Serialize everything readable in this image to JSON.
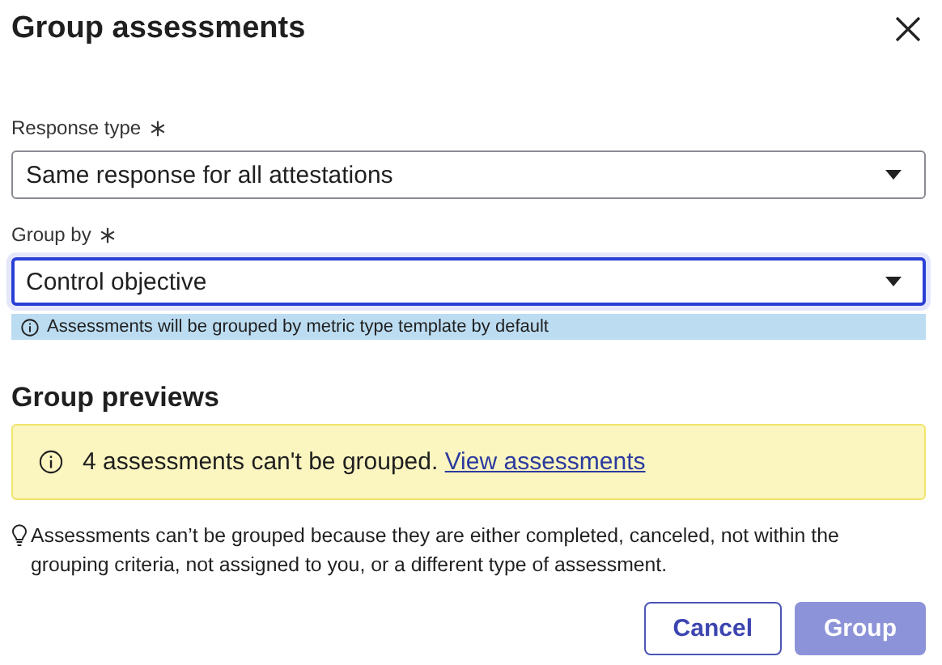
{
  "dialog": {
    "title": "Group assessments"
  },
  "fields": [
    {
      "label": "Response type",
      "required": true,
      "value": "Same response for all attestations",
      "focused": false
    },
    {
      "label": "Group by",
      "required": true,
      "value": "Control objective",
      "focused": true,
      "info": "Assessments will be grouped by metric type template by default"
    }
  ],
  "previews": {
    "heading": "Group previews",
    "warning": "4 assessments can't be grouped.",
    "link": "View assessments",
    "hint": "Assessments can’t be grouped because they are either completed, canceled, not within the grouping criteria, not assigned to you, or a different type of assessment."
  },
  "buttons": [
    {
      "label": "Cancel",
      "kind": "secondary",
      "disabled": false
    },
    {
      "label": "Group",
      "kind": "primary",
      "disabled": true
    }
  ]
}
